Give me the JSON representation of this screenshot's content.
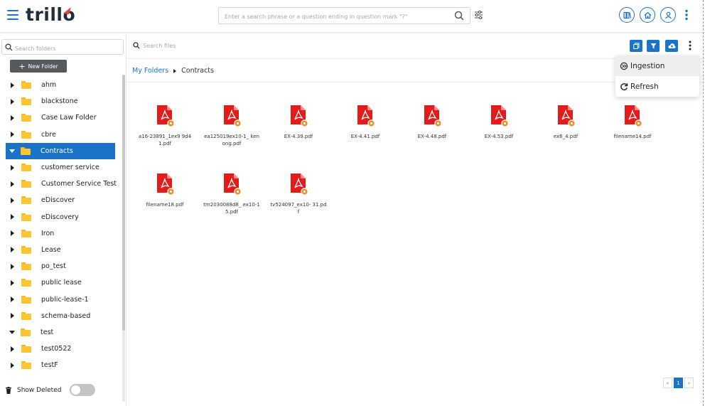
{
  "app": {
    "logo": "trillo"
  },
  "header": {
    "search_placeholder": "Enter a search phrase or a question ending in question mark \"?\""
  },
  "sidebar": {
    "search_placeholder": "Search folders",
    "new_folder_label": "New Folder",
    "folders": [
      {
        "label": "ahm",
        "expanded": false,
        "selected": false
      },
      {
        "label": "blackstone",
        "expanded": false,
        "selected": false
      },
      {
        "label": "Case Law Folder",
        "expanded": false,
        "selected": false
      },
      {
        "label": "cbre",
        "expanded": false,
        "selected": false
      },
      {
        "label": "Contracts",
        "expanded": true,
        "selected": true
      },
      {
        "label": "customer service",
        "expanded": false,
        "selected": false
      },
      {
        "label": "Customer Service Test",
        "expanded": false,
        "selected": false
      },
      {
        "label": "eDiscover",
        "expanded": false,
        "selected": false
      },
      {
        "label": "eDiscovery",
        "expanded": false,
        "selected": false
      },
      {
        "label": "Iron",
        "expanded": false,
        "selected": false
      },
      {
        "label": "Lease",
        "expanded": false,
        "selected": false
      },
      {
        "label": "po_test",
        "expanded": false,
        "selected": false
      },
      {
        "label": "public lease",
        "expanded": false,
        "selected": false
      },
      {
        "label": "public-lease-1",
        "expanded": false,
        "selected": false
      },
      {
        "label": "schema-based",
        "expanded": false,
        "selected": false
      },
      {
        "label": "test",
        "expanded": true,
        "selected": false
      },
      {
        "label": "test0522",
        "expanded": false,
        "selected": false
      },
      {
        "label": "testF",
        "expanded": false,
        "selected": false
      }
    ],
    "show_deleted_label": "Show Deleted"
  },
  "main": {
    "search_placeholder": "Search files",
    "breadcrumb": {
      "root": "My Folders",
      "current": "Contracts"
    },
    "files": [
      {
        "name": "a16-23891_1ex9 9d41.pdf"
      },
      {
        "name": "ea125019ex10-1_ kenong.pdf"
      },
      {
        "name": "EX-4.39.pdf"
      },
      {
        "name": "EX-4.41.pdf"
      },
      {
        "name": "EX-4.48.pdf"
      },
      {
        "name": "EX-4.53.pdf"
      },
      {
        "name": "ex6_4.pdf"
      },
      {
        "name": "filename14.pdf"
      },
      {
        "name": "filename18.pdf"
      },
      {
        "name": "tm2030088d8_ ex10-15.pdf"
      },
      {
        "name": "tv524097_ex10- 31.pdf"
      }
    ]
  },
  "dropdown": {
    "items": [
      {
        "label": "Ingestion",
        "icon": "ingestion-icon"
      },
      {
        "label": "Refresh",
        "icon": "refresh-icon"
      }
    ]
  },
  "pagination": {
    "prev": "«",
    "current": "1",
    "next": "»"
  },
  "colors": {
    "accent": "#1a73c9",
    "pdf_red": "#e41b1b",
    "folder": "#fcc531",
    "badge": "#f28b1c"
  }
}
